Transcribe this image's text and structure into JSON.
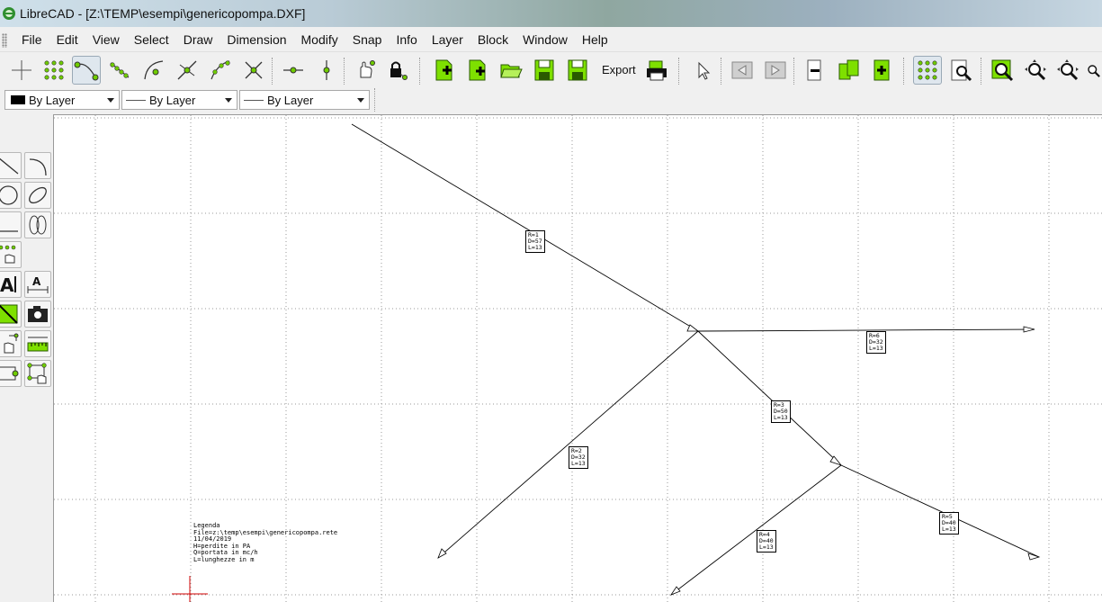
{
  "window": {
    "title": "LibreCAD - [Z:\\TEMP\\esempi\\genericopompa.DXF]"
  },
  "menu": [
    "File",
    "Edit",
    "View",
    "Select",
    "Draw",
    "Dimension",
    "Modify",
    "Snap",
    "Info",
    "Layer",
    "Block",
    "Window",
    "Help"
  ],
  "toolbar": {
    "export_label": "Export"
  },
  "pen": {
    "color": "By Layer",
    "width": "By Layer",
    "type": "By Layer"
  },
  "legend": {
    "lines": [
      "Legenda",
      "File=z:\\temp\\esempi\\genericopompa.rete",
      "11/04/2019",
      "H=perdite in PA",
      "Q=portata in mc/h",
      "L=lunghezze in m"
    ]
  },
  "pipes": [
    {
      "lines": [
        "R=1",
        "D=57",
        "L=13"
      ]
    },
    {
      "lines": [
        "R=6",
        "D=32",
        "L=13"
      ]
    },
    {
      "lines": [
        "R=3",
        "D=50",
        "L=13"
      ]
    },
    {
      "lines": [
        "R=2",
        "D=32",
        "L=13"
      ]
    },
    {
      "lines": [
        "R=4",
        "D=40",
        "L=13"
      ]
    },
    {
      "lines": [
        "R=5",
        "D=40",
        "L=13"
      ]
    }
  ],
  "colors": {
    "accent_green": "#7ee000",
    "crosshair": "#d00000"
  }
}
